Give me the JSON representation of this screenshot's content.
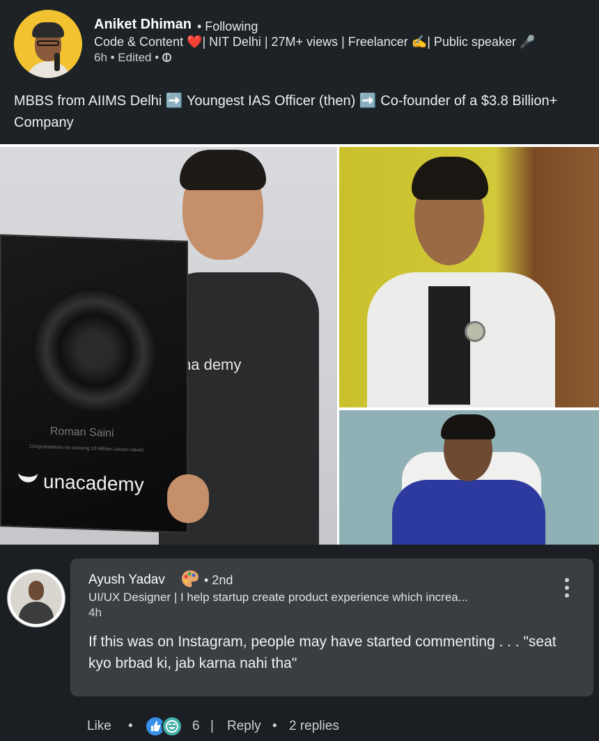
{
  "post": {
    "author_name": "Aniket Dhiman",
    "follow_status": "• Following",
    "author_headline": "Code & Content ❤️| NIT Delhi | 27M+ views | Freelancer ✍️| Public speaker 🎤",
    "meta": "6h • Edited •",
    "text": "MBBS from AIIMS Delhi ➡️  Youngest IAS Officer (then) ➡️ Co-founder of a $3.8 Billion+ Company"
  },
  "images": {
    "tshirt_brand": "na  demy",
    "plaque_name": "Roman Saini",
    "plaque_caption": "Congratulations on crossing 10 Million Lesson views!",
    "plaque_brand": "unacademy"
  },
  "comment": {
    "name": "Ayush Yadav",
    "degree": "• 2nd",
    "headline": "UI/UX Designer | I help startup create product experience which increa...",
    "time": "4h",
    "text": "If this was on Instagram,  people may have started commenting . . . \"seat kyo brbad ki,  jab karna nahi tha\""
  },
  "actions": {
    "like": "Like",
    "dot1": "•",
    "reaction_count": "6",
    "divider": "|",
    "reply": "Reply",
    "dot2": "•",
    "replies": "2 replies"
  }
}
